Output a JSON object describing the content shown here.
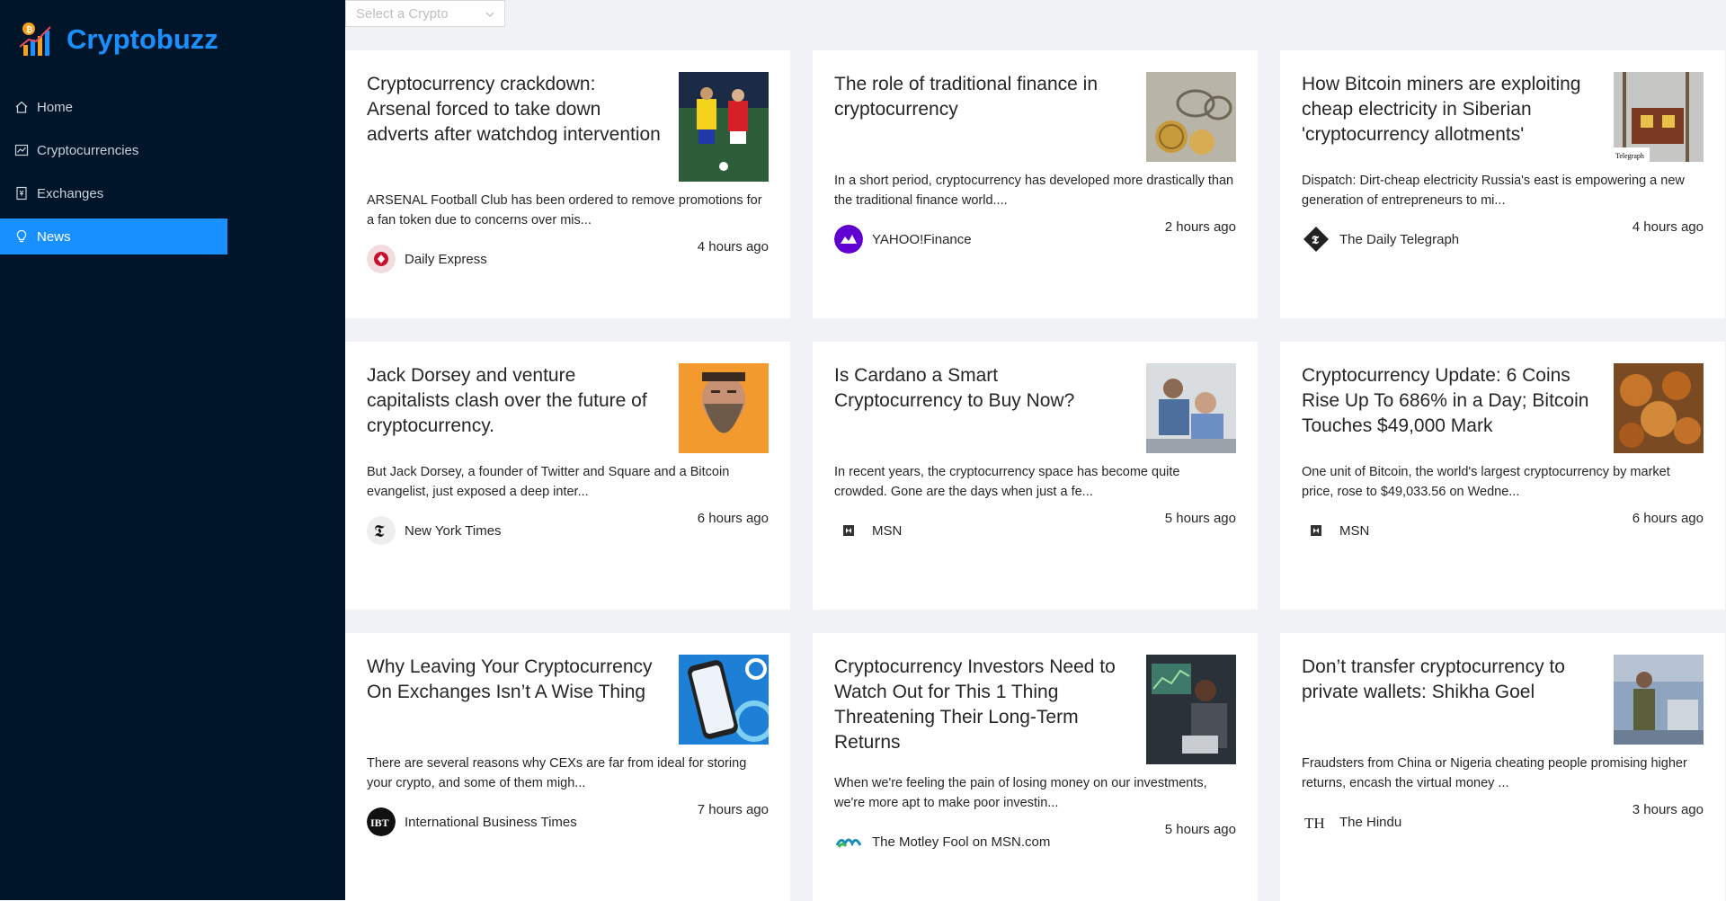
{
  "app": {
    "name": "Cryptobuzz"
  },
  "sidebar": {
    "items": [
      {
        "label": "Home",
        "icon": "home-icon",
        "active": false
      },
      {
        "label": "Cryptocurrencies",
        "icon": "fund-icon",
        "active": false
      },
      {
        "label": "Exchanges",
        "icon": "money-collect-icon",
        "active": false
      },
      {
        "label": "News",
        "icon": "bulb-icon",
        "active": true
      }
    ]
  },
  "select": {
    "placeholder": "Select a Crypto"
  },
  "colors": {
    "accent": "#1890ff",
    "sidebar": "#001529",
    "background": "#f0f2f5"
  },
  "news": [
    {
      "title": "Cryptocurrency crackdown: Arsenal forced to take down adverts after watchdog intervention",
      "desc": "ARSENAL Football Club has been ordered to remove promotions for a fan token due to concerns over mis...",
      "provider": "Daily Express",
      "time": "4 hours ago"
    },
    {
      "title": "The role of traditional finance in cryptocurrency",
      "desc": "In a short period, cryptocurrency has developed more drastically than the traditional finance world....",
      "provider": "YAHOO!Finance",
      "time": "2 hours ago"
    },
    {
      "title": "How Bitcoin miners are exploiting cheap electricity in Siberian 'cryptocurrency allotments'",
      "desc": "Dispatch: Dirt-cheap electricity Russia's east is empowering a new generation of entrepreneurs to mi...",
      "provider": "The Daily Telegraph",
      "time": "4 hours ago"
    },
    {
      "title": "Jack Dorsey and venture capitalists clash over the future of cryptocurrency.",
      "desc": "But Jack Dorsey, a founder of Twitter and Square and a Bitcoin evangelist, just exposed a deep inter...",
      "provider": "New York Times",
      "time": "6 hours ago"
    },
    {
      "title": "Is Cardano a Smart Cryptocurrency to Buy Now?",
      "desc": "In recent years, the cryptocurrency space has become quite crowded. Gone are the days when just a fe...",
      "provider": "MSN",
      "time": "5 hours ago"
    },
    {
      "title": "Cryptocurrency Update: 6 Coins Rise Up To 686% in a Day; Bitcoin Touches $49,000 Mark",
      "desc": "One unit of Bitcoin, the world's largest cryptocurrency by market price, rose to $49,033.56 on Wedne...",
      "provider": "MSN",
      "time": "6 hours ago"
    },
    {
      "title": "Why Leaving Your Cryptocurrency On Exchanges Isn’t A Wise Thing",
      "desc": "There are several reasons why CEXs are far from ideal for storing your crypto, and some of them migh...",
      "provider": "International Business Times",
      "time": "7 hours ago"
    },
    {
      "title": "Cryptocurrency Investors Need to Watch Out for This 1 Thing Threatening Their Long-Term Returns",
      "desc": "When we're feeling the pain of losing money on our investments, we're more apt to make poor investin...",
      "provider": "The Motley Fool on MSN.com",
      "time": "5 hours ago"
    },
    {
      "title": "Don’t transfer cryptocurrency to private wallets: Shikha Goel",
      "desc": "Fraudsters from China or Nigeria cheating people promising higher returns, encash the virtual money ...",
      "provider": "The Hindu",
      "time": "3 hours ago"
    }
  ],
  "thumb_labels": {
    "telegraph": "Telegraph"
  },
  "provider_logo_text": {
    "nyt": "𝕿",
    "ibt": "IBT",
    "hindu": "TH"
  }
}
